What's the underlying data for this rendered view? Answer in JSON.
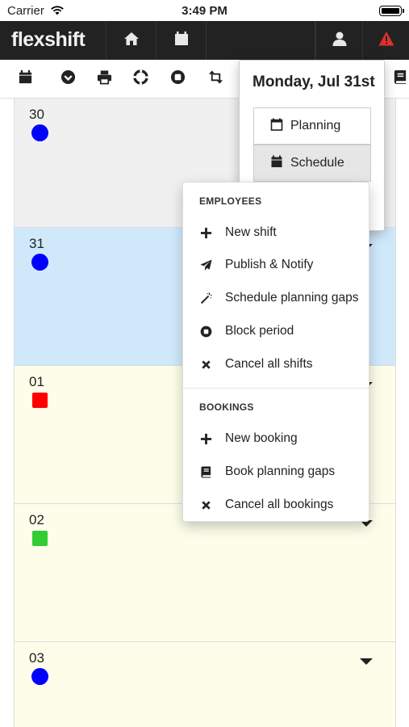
{
  "status_bar": {
    "carrier": "Carrier",
    "time": "3:49 PM"
  },
  "navbar": {
    "brand_text": "flexshift",
    "icons": [
      "home-icon",
      "calendar-icon",
      "user-icon",
      "warning-icon"
    ]
  },
  "toolbar": {
    "icons": [
      "calendar-icon",
      "check-circle-icon",
      "print-icon",
      "lifebuoy-icon",
      "stop-circle-icon",
      "retweet-icon",
      "book-icon"
    ]
  },
  "days": [
    {
      "num": "30",
      "color": "#0000ff",
      "shape": "circle",
      "bg": "#f0f0f0"
    },
    {
      "num": "31",
      "color": "#0000ff",
      "shape": "circle",
      "bg": "#cfe9fb"
    },
    {
      "num": "01",
      "color": "#ff0000",
      "shape": "square",
      "bg": "#fdfdea"
    },
    {
      "num": "02",
      "color": "#33cc33",
      "shape": "square",
      "bg": "#fdfdea"
    },
    {
      "num": "03",
      "color": "#0000ff",
      "shape": "circle",
      "bg": "#fdfdea"
    }
  ],
  "date_popover": {
    "title": "Monday, Jul 31st",
    "planning_label": "Planning",
    "schedule_label": "Schedule"
  },
  "dropdown": {
    "employees_header": "EMPLOYEES",
    "employees_items": [
      {
        "label": "New shift",
        "icon": "plus-icon"
      },
      {
        "label": "Publish & Notify",
        "icon": "paper-plane-icon"
      },
      {
        "label": "Schedule planning gaps",
        "icon": "magic-wand-icon"
      },
      {
        "label": "Block period",
        "icon": "stop-circle-icon"
      },
      {
        "label": "Cancel all shifts",
        "icon": "times-icon"
      }
    ],
    "bookings_header": "BOOKINGS",
    "bookings_items": [
      {
        "label": "New booking",
        "icon": "plus-icon"
      },
      {
        "label": "Book planning gaps",
        "icon": "book-icon"
      },
      {
        "label": "Cancel all bookings",
        "icon": "times-icon"
      }
    ]
  },
  "colors": {
    "navbar_bg": "#222222",
    "brand_accent": "#1aa3d9",
    "alert": "#e0302b"
  }
}
